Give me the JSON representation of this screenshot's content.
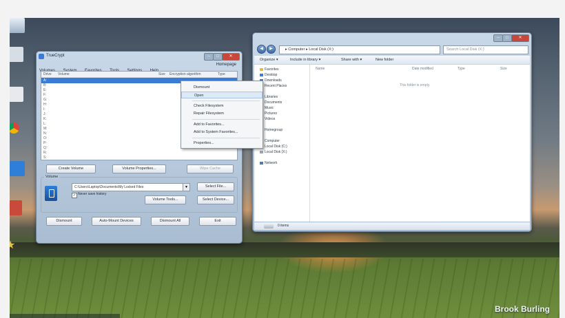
{
  "watermark": "Brook Burling",
  "truecrypt": {
    "title": "TrueCrypt",
    "window_controls": {
      "minimize": "–",
      "maximize": "□",
      "close": "✕"
    },
    "menu": [
      "Volumes",
      "System",
      "Favorites",
      "Tools",
      "Settings",
      "Help"
    ],
    "homepage": "Homepage",
    "columns": [
      "Drive",
      "Volume",
      "Size",
      "Encryption algorithm",
      "Type"
    ],
    "drives": [
      "A:",
      "B:",
      "E:",
      "F:",
      "G:",
      "H:",
      "I:",
      "J:",
      "K:",
      "L:",
      "M:",
      "N:",
      "O:",
      "P:",
      "Q:",
      "R:",
      "S:"
    ],
    "buttons": {
      "create_volume": "Create Volume",
      "volume_properties": "Volume Properties...",
      "wipe_cache": "Wipe Cache",
      "select_file": "Select File...",
      "volume_tools": "Volume Tools...",
      "select_device": "Select Device...",
      "dismount": "Dismount",
      "auto_mount": "Auto-Mount Devices",
      "dismount_all": "Dismount All",
      "exit": "Exit"
    },
    "volume_group_label": "Volume",
    "volume_path": "C:\\Users\\Laptop\\Documents\\My Locked Files",
    "never_save_history": "Never save history"
  },
  "context_menu": {
    "items": [
      "Dismount",
      "Open",
      "Check Filesystem",
      "Repair Filesystem",
      "Add to Favorites...",
      "Add to System Favorites...",
      "Properties..."
    ],
    "highlighted": "Open"
  },
  "explorer": {
    "window_controls": {
      "minimize": "–",
      "maximize": "□",
      "close": "✕"
    },
    "nav_back": "◀",
    "nav_forward": "▶",
    "address": "▸ Computer ▸ Local Disk (X:)",
    "search_placeholder": "Search Local Disk (X:)",
    "toolbar": [
      "Organize ▾",
      "Include in library ▾",
      "Share with ▾",
      "New folder"
    ],
    "nav_items": [
      {
        "label": "Favorites",
        "color": "#e8b93c"
      },
      {
        "label": "Desktop",
        "color": "#3a7bd5"
      },
      {
        "label": "Downloads",
        "color": "#3a7bd5"
      },
      {
        "label": "Recent Places",
        "color": "#8a9bb0"
      },
      {
        "label": "Libraries",
        "color": "#e8b93c"
      },
      {
        "label": "Documents",
        "color": "#c9a25a"
      },
      {
        "label": "Music",
        "color": "#3a7bd5"
      },
      {
        "label": "Pictures",
        "color": "#4a9a5a"
      },
      {
        "label": "Videos",
        "color": "#5a6fb0"
      },
      {
        "label": "Homegroup",
        "color": "#4a8ac8"
      },
      {
        "label": "Computer",
        "color": "#5a7aa0"
      },
      {
        "label": "Local Disk (C:)",
        "color": "#9aa6b2"
      },
      {
        "label": "Local Disk (X:)",
        "color": "#9aa6b2"
      },
      {
        "label": "Network",
        "color": "#4a7ab0"
      }
    ],
    "columns": [
      "Name",
      "Date modified",
      "Type",
      "Size"
    ],
    "empty_message": "This folder is empty.",
    "status": "0 items"
  }
}
